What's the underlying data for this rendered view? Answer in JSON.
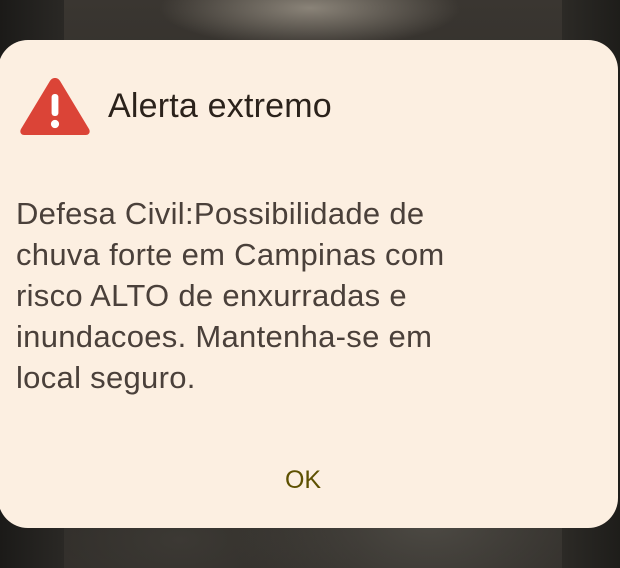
{
  "alert": {
    "title": "Alerta extremo",
    "icon": "warning-triangle-icon",
    "icon_color": "#db4437",
    "message": "Defesa Civil:Possibilidade de\nchuva forte em Campinas com\nrisco ALTO de enxurradas e\ninundacoes. Mantenha-se em\nlocal seguro.",
    "ok_label": "OK"
  },
  "colors": {
    "dialog_background": "#fcefe1",
    "title_text": "#2b221b",
    "message_text": "#4a403a",
    "button_text": "#5d5000"
  }
}
